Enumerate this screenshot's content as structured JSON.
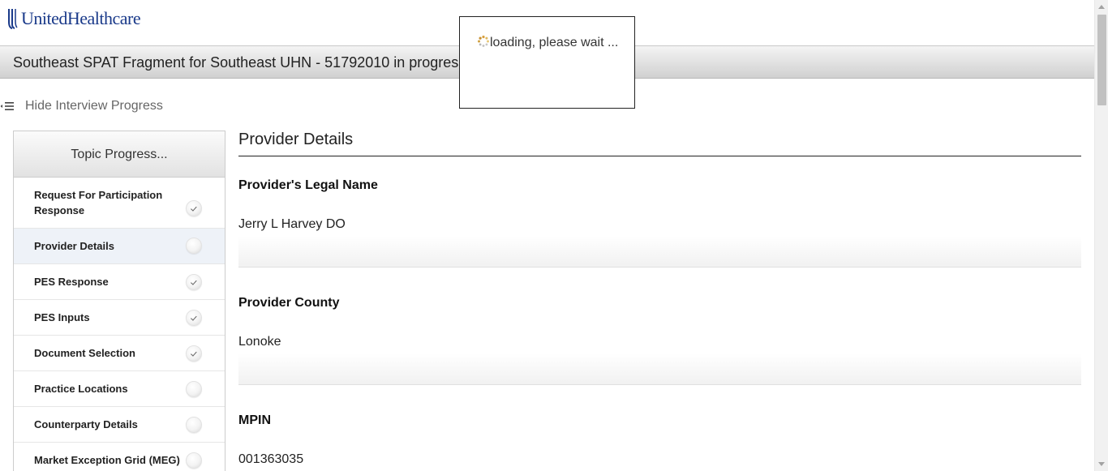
{
  "brand": {
    "name": "UnitedHealthcare",
    "color": "#1a3a8a"
  },
  "title_bar": {
    "text": "Southeast SPAT Fragment for Southeast UHN - 51792010 in progress"
  },
  "loading": {
    "text": "loading, please wait ..."
  },
  "hide_progress": {
    "label": "Hide Interview Progress",
    "icon": "menu-collapse-icon"
  },
  "topic_panel": {
    "header": "Topic Progress...",
    "items": [
      {
        "label": "Request For Participation Response",
        "status": "complete",
        "active": false
      },
      {
        "label": "Provider Details",
        "status": "incomplete",
        "active": true
      },
      {
        "label": "PES Response",
        "status": "complete",
        "active": false
      },
      {
        "label": "PES Inputs",
        "status": "complete",
        "active": false
      },
      {
        "label": "Document Selection",
        "status": "complete",
        "active": false
      },
      {
        "label": "Practice Locations",
        "status": "incomplete",
        "active": false
      },
      {
        "label": "Counterparty Details",
        "status": "incomplete",
        "active": false
      },
      {
        "label": "Market Exception Grid (MEG)",
        "status": "incomplete",
        "active": false
      }
    ]
  },
  "main": {
    "section_title": "Provider Details",
    "fields": [
      {
        "label": "Provider's Legal Name",
        "value": "Jerry L Harvey DO"
      },
      {
        "label": "Provider County",
        "value": "Lonoke"
      },
      {
        "label": "MPIN",
        "value": "001363035"
      }
    ]
  }
}
